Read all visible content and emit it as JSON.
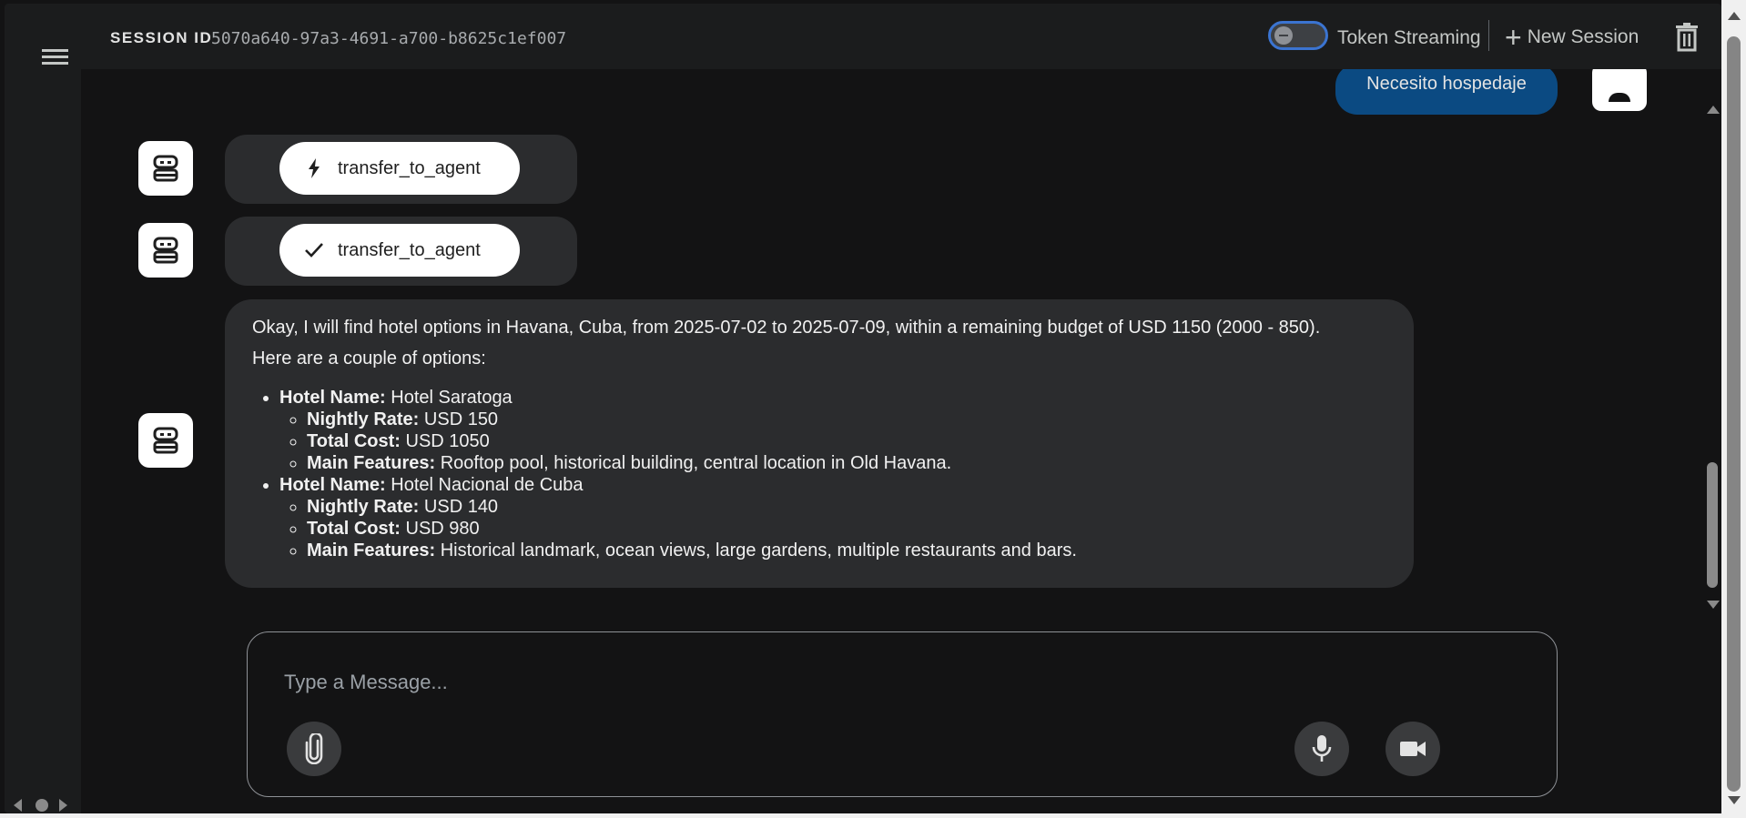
{
  "header": {
    "session_label": "SESSION ID",
    "session_id": "5070a640-97a3-4691-a700-b8625c1ef007",
    "streaming_label": "Token Streaming",
    "streaming_enabled": false,
    "new_session_label": "New Session"
  },
  "chat": {
    "user_message": "Necesito hospedaje",
    "tool_calls": [
      {
        "icon": "bolt-icon",
        "label": "transfer_to_agent"
      },
      {
        "icon": "check-icon",
        "label": "transfer_to_agent"
      }
    ],
    "assistant_message": {
      "intro": "Okay, I will find hotel options in Havana, Cuba, from 2025-07-02 to 2025-07-09, within a remaining budget of USD 1150 (2000 - 850).",
      "lead": "Here are a couple of options:",
      "hotels": [
        {
          "name_label": "Hotel Name:",
          "name": "Hotel Saratoga",
          "rate_label": "Nightly Rate:",
          "rate": "USD 150",
          "total_label": "Total Cost:",
          "total": "USD 1050",
          "features_label": "Main Features:",
          "features": "Rooftop pool, historical building, central location in Old Havana."
        },
        {
          "name_label": "Hotel Name:",
          "name": "Hotel Nacional de Cuba",
          "rate_label": "Nightly Rate:",
          "rate": "USD 140",
          "total_label": "Total Cost:",
          "total": "USD 980",
          "features_label": "Main Features:",
          "features": "Historical landmark, ocean views, large gardens, multiple restaurants and bars."
        }
      ]
    }
  },
  "composer": {
    "placeholder": "Type a Message..."
  },
  "colors": {
    "background": "#131314",
    "panel": "#1b1c1d",
    "bubble": "#2b2c2e",
    "user_bubble": "#0b4a82",
    "toggle_border": "#3b74d1"
  }
}
